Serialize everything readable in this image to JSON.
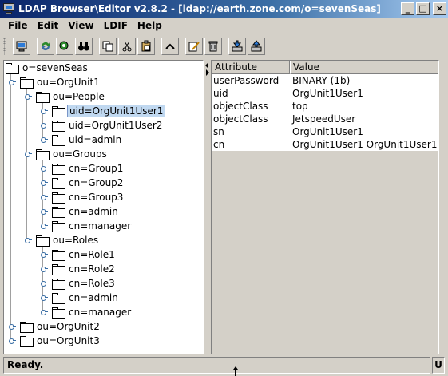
{
  "window": {
    "title": "LDAP Browser\\Editor v2.8.2 - [ldap://earth.zone.com/o=sevenSeas]",
    "buttons": {
      "minimize": "_",
      "maximize": "□",
      "close": "×"
    }
  },
  "menu": {
    "items": [
      {
        "label": "File",
        "key": "file"
      },
      {
        "label": "Edit",
        "key": "edit"
      },
      {
        "label": "View",
        "key": "view"
      },
      {
        "label": "LDIF",
        "key": "ldif"
      },
      {
        "label": "Help",
        "key": "help"
      }
    ]
  },
  "toolbar": {
    "buttons": [
      {
        "icon": "connect-icon",
        "group": 1
      },
      {
        "icon": "refresh-icon",
        "group": 2
      },
      {
        "icon": "find-icon",
        "group": 2
      },
      {
        "icon": "binoculars-icon",
        "group": 2
      },
      {
        "icon": "copy-icon",
        "group": 3
      },
      {
        "icon": "cut-icon",
        "group": 3
      },
      {
        "icon": "paste-icon",
        "group": 3
      },
      {
        "icon": "up-icon",
        "group": 4
      },
      {
        "icon": "edit-icon",
        "group": 5
      },
      {
        "icon": "delete-icon",
        "group": 5
      },
      {
        "icon": "import-icon",
        "group": 6
      },
      {
        "icon": "export-icon",
        "group": 6
      }
    ]
  },
  "tree": {
    "nodes": [
      {
        "label": "o=sevenSeas",
        "depth": 0
      },
      {
        "label": "ou=OrgUnit1",
        "depth": 1
      },
      {
        "label": "ou=People",
        "depth": 2
      },
      {
        "label": "uid=OrgUnit1User1",
        "depth": 3,
        "selected": true
      },
      {
        "label": "uid=OrgUnit1User2",
        "depth": 3
      },
      {
        "label": "uid=admin",
        "depth": 3
      },
      {
        "label": "ou=Groups",
        "depth": 2
      },
      {
        "label": "cn=Group1",
        "depth": 3
      },
      {
        "label": "cn=Group2",
        "depth": 3
      },
      {
        "label": "cn=Group3",
        "depth": 3
      },
      {
        "label": "cn=admin",
        "depth": 3
      },
      {
        "label": "cn=manager",
        "depth": 3
      },
      {
        "label": "ou=Roles",
        "depth": 2
      },
      {
        "label": "cn=Role1",
        "depth": 3
      },
      {
        "label": "cn=Role2",
        "depth": 3
      },
      {
        "label": "cn=Role3",
        "depth": 3
      },
      {
        "label": "cn=admin",
        "depth": 3
      },
      {
        "label": "cn=manager",
        "depth": 3
      },
      {
        "label": "ou=OrgUnit2",
        "depth": 1
      },
      {
        "label": "ou=OrgUnit3",
        "depth": 1
      }
    ]
  },
  "table": {
    "headers": {
      "attribute": "Attribute",
      "value": "Value"
    },
    "rows": [
      {
        "attribute": "userPassword",
        "value": "BINARY (1b)"
      },
      {
        "attribute": "uid",
        "value": "OrgUnit1User1"
      },
      {
        "attribute": "objectClass",
        "value": "top"
      },
      {
        "attribute": "objectClass",
        "value": "JetspeedUser"
      },
      {
        "attribute": "sn",
        "value": "OrgUnit1User1"
      },
      {
        "attribute": "cn",
        "value": "OrgUnit1User1 OrgUnit1User1"
      }
    ]
  },
  "status": {
    "text": "Ready.",
    "mode": "U"
  },
  "colors": {
    "title_start": "#0a246a",
    "title_end": "#a6caf0",
    "selection": "#c0d8f0",
    "face": "#d4d0c8"
  }
}
